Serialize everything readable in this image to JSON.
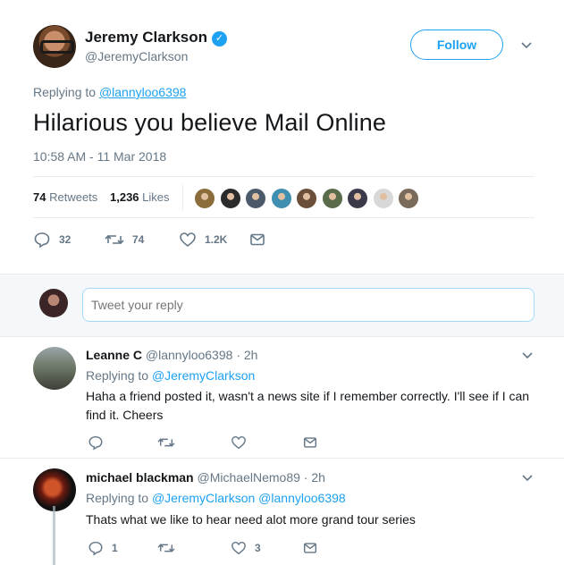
{
  "tweet": {
    "author_name": "Jeremy Clarkson",
    "author_handle": "@JeremyClarkson",
    "follow_label": "Follow",
    "replying_prefix": "Replying to",
    "replying_to": "@lannyloo6398",
    "text": "Hilarious you believe Mail Online",
    "timestamp": "10:58 AM - 11 Mar 2018",
    "retweets_count": "74",
    "retweets_label": "Retweets",
    "likes_count": "1,236",
    "likes_label": "Likes",
    "actions": {
      "replies": "32",
      "retweets": "74",
      "likes": "1.2K"
    }
  },
  "reply_box": {
    "placeholder": "Tweet your reply"
  },
  "replies": [
    {
      "name": "Leanne C",
      "handle": "@lannyloo6398",
      "time": "· 2h",
      "replying_prefix": "Replying to",
      "replying_to": "@JeremyClarkson",
      "text": "Haha a friend posted it, wasn't a news site if I remember correctly. I'll see if I can find it. Cheers",
      "reply_count": "",
      "like_count": ""
    },
    {
      "name": "michael blackman",
      "handle": "@MichaelNemo89",
      "time": "· 2h",
      "replying_prefix": "Replying to",
      "replying_to": "@JeremyClarkson @lannyloo6398",
      "text": "Thats what we like to hear need alot more grand tour series",
      "reply_count": "1",
      "like_count": "3"
    }
  ],
  "colors": {
    "accent": "#1da1f2",
    "muted": "#657786",
    "border": "#e6ecf0",
    "reply_bg": "#f5f8fa"
  },
  "likers": [
    "#8a6d3b",
    "#2b2b2b",
    "#4a5a6a",
    "#3f8fb0",
    "#6b4f3a",
    "#5a6b4a",
    "#3a3a4a",
    "#d8d8d8",
    "#7a6a5a"
  ]
}
